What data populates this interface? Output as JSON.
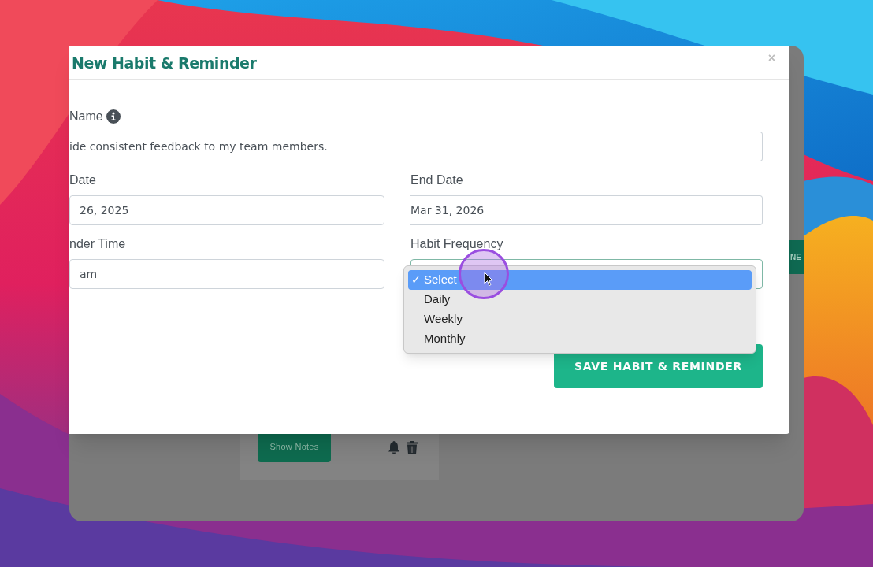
{
  "dialog": {
    "title": "New Habit & Reminder",
    "close": "×"
  },
  "fields": [
    {
      "kind": "text",
      "label": "Name",
      "info": true,
      "value": "ide consistent feedback to my team members."
    },
    {
      "kind": "text",
      "label": "Date",
      "info": false,
      "value": "26, 2025"
    },
    {
      "kind": "text",
      "label": "End Date",
      "info": false,
      "value": "Mar 31, 2026"
    },
    {
      "kind": "text",
      "label": "nder Time",
      "info": false,
      "value": "am"
    },
    {
      "kind": "select",
      "label": "Habit Frequency",
      "info": false,
      "check_mark": "✓",
      "options": [
        {
          "label": "Select",
          "selected": true
        },
        {
          "label": "Daily",
          "selected": false
        },
        {
          "label": "Weekly",
          "selected": false
        },
        {
          "label": "Monthly",
          "selected": false
        }
      ]
    }
  ],
  "save_button": "SAVE HABIT & REMINDER",
  "behind": {
    "side_button": "NE",
    "card_button": "Show Notes"
  }
}
